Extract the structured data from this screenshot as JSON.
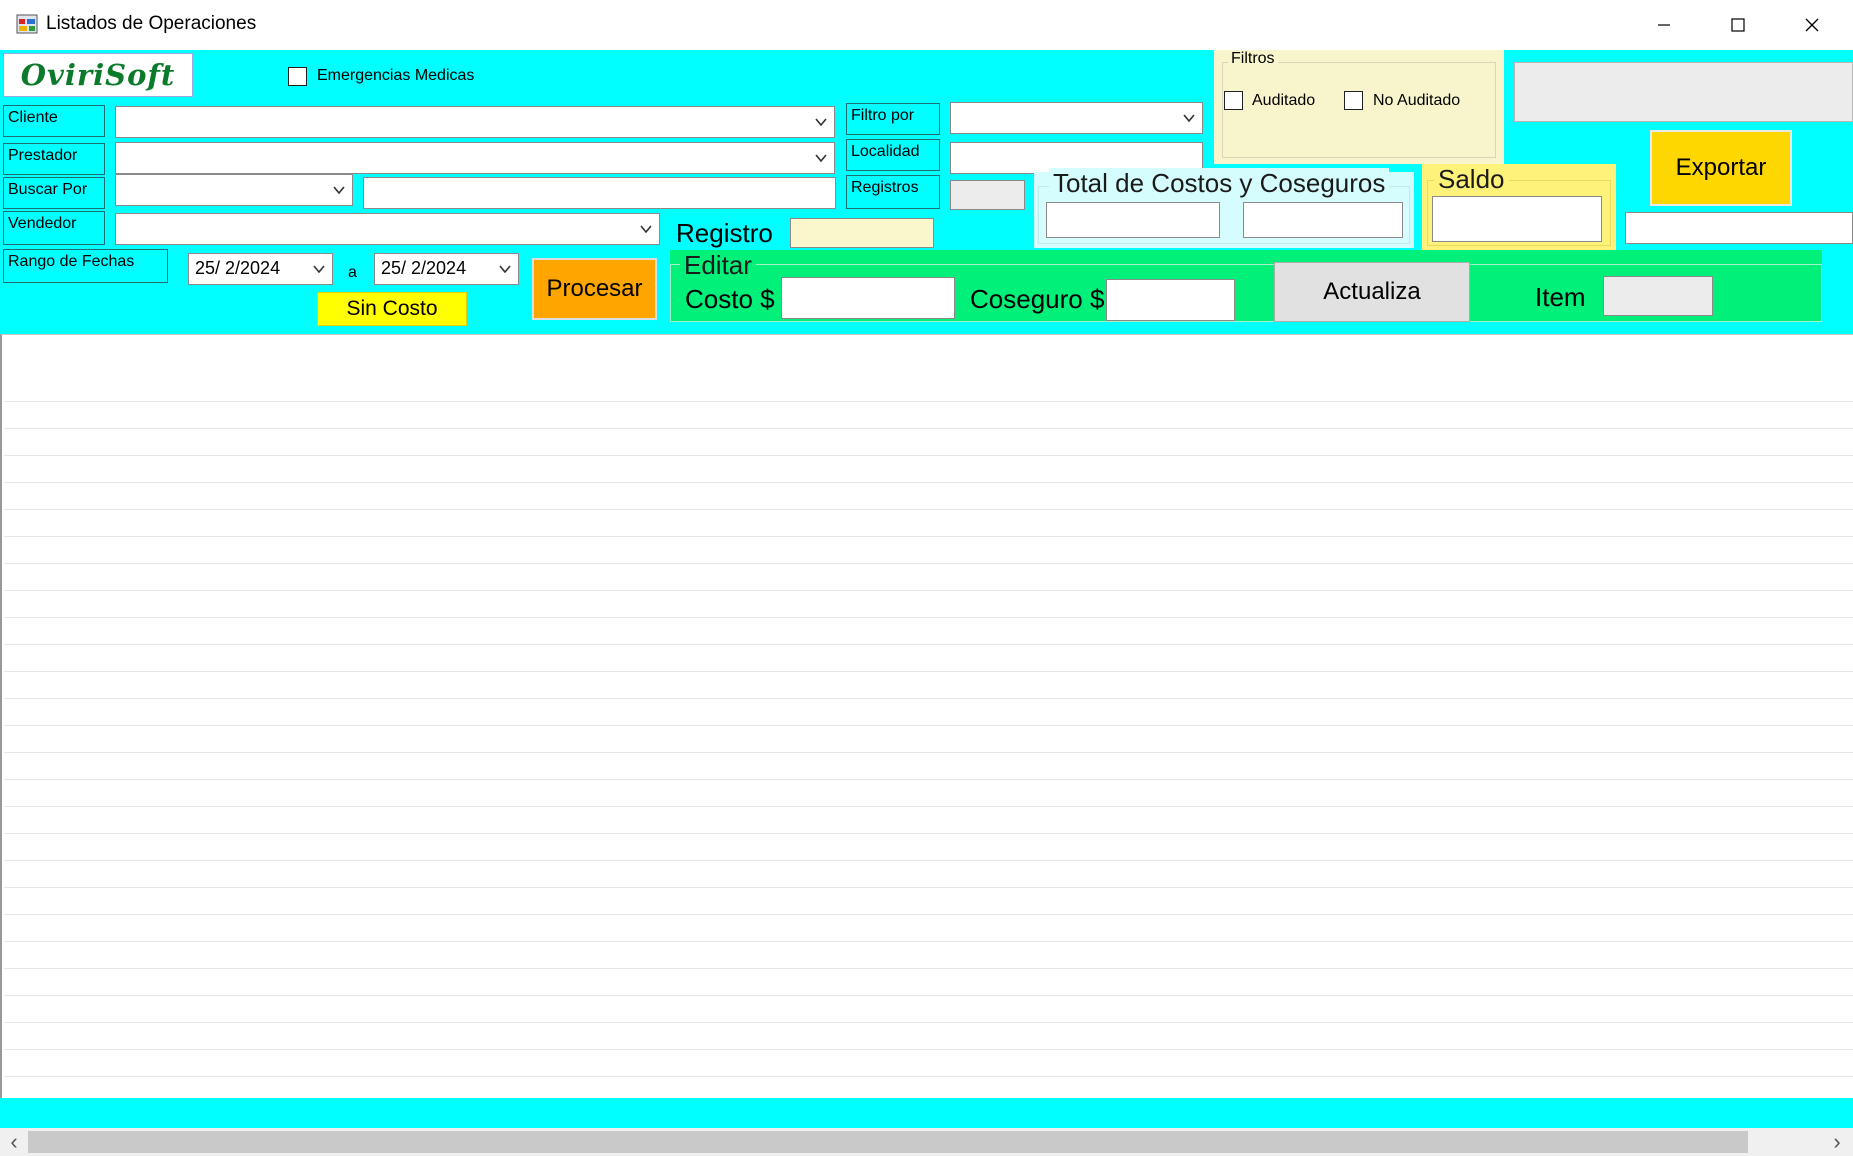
{
  "window": {
    "title": "Listados de Operaciones",
    "minimize_glyph": "—",
    "maximize_glyph": "☐",
    "close_glyph": "✕"
  },
  "logo": {
    "text": "OviriSoft"
  },
  "emergencias": {
    "label": "Emergencias Medicas",
    "checked": false
  },
  "fields": {
    "cliente_label": "Cliente",
    "prestador_label": "Prestador",
    "buscar_por_label": "Buscar Por",
    "vendedor_label": "Vendedor",
    "rango_fechas_label": "Rango de Fechas",
    "filtro_por_label": "Filtro por",
    "localidad_label": "Localidad",
    "registros_label": "Registros",
    "registro_label": "Registro"
  },
  "dates": {
    "from": "25/ 2/2024",
    "separator": "a",
    "to": "25/ 2/2024"
  },
  "buttons": {
    "sin_costo": "Sin Costo",
    "procesar": "Procesar",
    "exportar": "Exportar",
    "actualiza": "Actualiza"
  },
  "filtros": {
    "title": "Filtros",
    "auditado": "Auditado",
    "no_auditado": "No Auditado"
  },
  "totales": {
    "title": "Total de Costos y Coseguros"
  },
  "saldo": {
    "title": "Saldo"
  },
  "editar": {
    "title": "Editar",
    "costo_label": "Costo $",
    "coseguro_label": "Coseguro $",
    "item_label": "Item"
  },
  "colors": {
    "panel": "#00ffff",
    "filtros_bg": "#f8f5cc",
    "saldo_bg": "#fff27a",
    "editar_bg": "#00f07a",
    "procesar_bg": "#ffa500",
    "exportar_bg": "#ffd700",
    "sin_costo_bg": "#ffff00",
    "logo_green": "#0b7a2a"
  },
  "scrollbar": {
    "left_glyph": "‹",
    "right_glyph": "›"
  }
}
